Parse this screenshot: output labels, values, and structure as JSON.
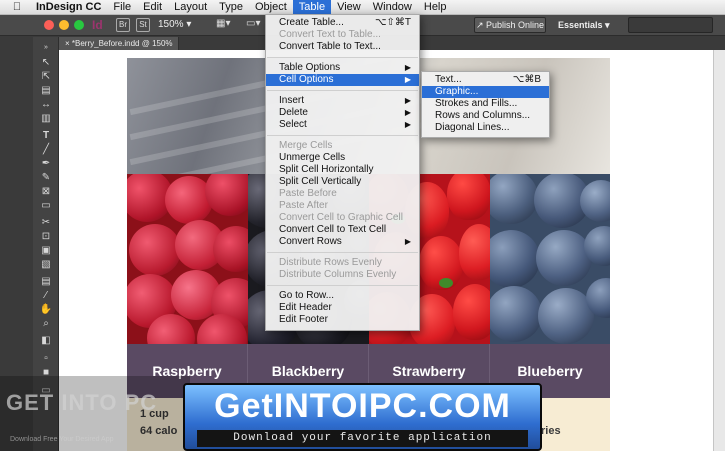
{
  "menubar": {
    "app_name": "InDesign CC",
    "items": [
      "File",
      "Edit",
      "Layout",
      "Type",
      "Object",
      "Table",
      "View",
      "Window",
      "Help"
    ],
    "active_item": "Table"
  },
  "appbar": {
    "logo": "Id",
    "zoom": "150%",
    "publish_label": "Publish Online",
    "workspace_label": "Essentials"
  },
  "document": {
    "tab_title": "*Berry_Before.indd @ 150%"
  },
  "page": {
    "fruits": [
      "Raspberry",
      "Blackberry",
      "Strawberry",
      "Blueberry"
    ],
    "row_text_1": "1 cup",
    "row_text_2": "64 calo",
    "row_text_3": "ries"
  },
  "table_menu": {
    "items": [
      {
        "label": "Create Table...",
        "shortcut": "⌥⇧⌘T",
        "disabled": false
      },
      {
        "label": "Convert Text to Table...",
        "disabled": true
      },
      {
        "label": "Convert Table to Text...",
        "disabled": false
      },
      {
        "label": "Table Options",
        "submenu": true
      },
      {
        "label": "Cell Options",
        "submenu": true,
        "highlighted": true
      },
      {
        "label": "Insert",
        "submenu": true
      },
      {
        "label": "Delete",
        "submenu": true
      },
      {
        "label": "Select",
        "submenu": true
      },
      {
        "label": "Merge Cells",
        "disabled": true
      },
      {
        "label": "Unmerge Cells",
        "disabled": false
      },
      {
        "label": "Split Cell Horizontally",
        "disabled": false
      },
      {
        "label": "Split Cell Vertically",
        "disabled": false
      },
      {
        "label": "Paste Before",
        "disabled": true
      },
      {
        "label": "Paste After",
        "disabled": true
      },
      {
        "label": "Convert Cell to Graphic Cell",
        "disabled": true
      },
      {
        "label": "Convert Cell to Text Cell",
        "disabled": false
      },
      {
        "label": "Convert Rows",
        "submenu": true
      },
      {
        "label": "Distribute Rows Evenly",
        "disabled": true
      },
      {
        "label": "Distribute Columns Evenly",
        "disabled": true
      },
      {
        "label": "Go to Row...",
        "disabled": false
      },
      {
        "label": "Edit Header",
        "disabled": false
      },
      {
        "label": "Edit Footer",
        "disabled": false
      }
    ]
  },
  "cell_options_submenu": {
    "items": [
      {
        "label": "Text...",
        "shortcut": "⌥⌘B"
      },
      {
        "label": "Graphic...",
        "highlighted": true
      },
      {
        "label": "Strokes and Fills..."
      },
      {
        "label": "Rows and Columns..."
      },
      {
        "label": "Diagonal Lines..."
      }
    ]
  },
  "watermark": {
    "left_title": "GET INTO PC",
    "left_subtitle": "Download Free Your Desired App",
    "badge_title": "GetINTOIPC.COM",
    "badge_subtitle": "Download your favorite application"
  },
  "colors": {
    "menu_highlight": "#2b6fd6",
    "fruit_header_bg": "#5a4a63",
    "cream_row_bg": "#f7ecd3"
  }
}
